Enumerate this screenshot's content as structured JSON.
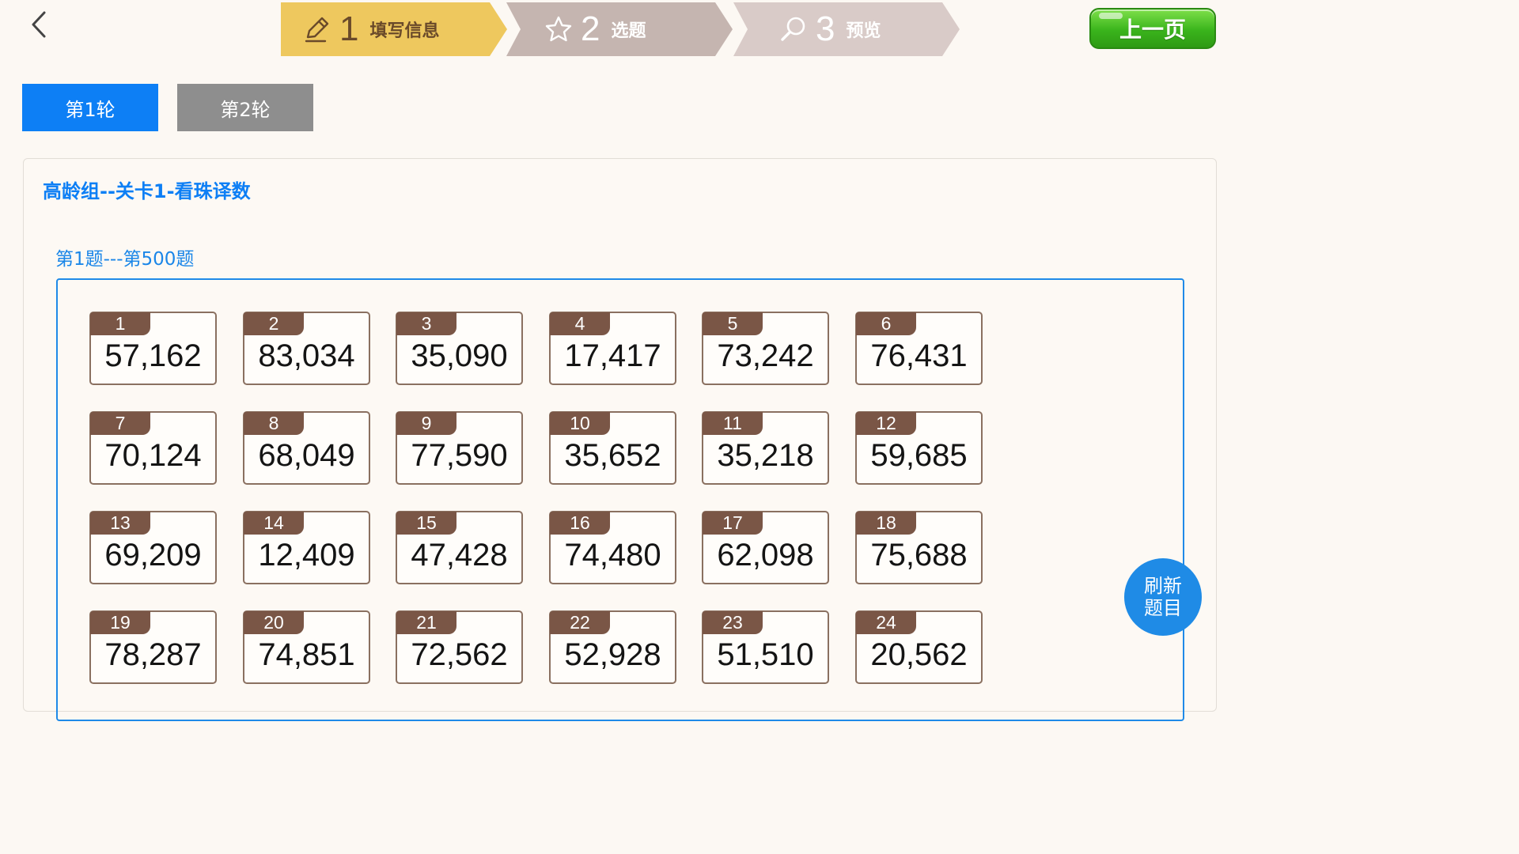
{
  "nav": {
    "back_icon": "chevron-left-icon"
  },
  "steps": [
    {
      "number": "1",
      "label": "填写信息",
      "icon": "pencil-icon",
      "color": "#eec85e"
    },
    {
      "number": "2",
      "label": "选题",
      "icon": "star-icon",
      "color": "#c5b5b0"
    },
    {
      "number": "3",
      "label": "预览",
      "icon": "magnifier-icon",
      "color": "#d9cbc8"
    }
  ],
  "header": {
    "prev_page_label": "上一页"
  },
  "rounds": [
    {
      "label": "第1轮",
      "active": true
    },
    {
      "label": "第2轮",
      "active": false
    }
  ],
  "panel": {
    "title": "高龄组--关卡1-看珠译数",
    "range_label": "第1题---第500题"
  },
  "questions": [
    {
      "id": "1",
      "value": "57,162"
    },
    {
      "id": "2",
      "value": "83,034"
    },
    {
      "id": "3",
      "value": "35,090"
    },
    {
      "id": "4",
      "value": "17,417"
    },
    {
      "id": "5",
      "value": "73,242"
    },
    {
      "id": "6",
      "value": "76,431"
    },
    {
      "id": "7",
      "value": "70,124"
    },
    {
      "id": "8",
      "value": "68,049"
    },
    {
      "id": "9",
      "value": "77,590"
    },
    {
      "id": "10",
      "value": "35,652"
    },
    {
      "id": "11",
      "value": "35,218"
    },
    {
      "id": "12",
      "value": "59,685"
    },
    {
      "id": "13",
      "value": "69,209"
    },
    {
      "id": "14",
      "value": "12,409"
    },
    {
      "id": "15",
      "value": "47,428"
    },
    {
      "id": "16",
      "value": "74,480"
    },
    {
      "id": "17",
      "value": "62,098"
    },
    {
      "id": "18",
      "value": "75,688"
    },
    {
      "id": "19",
      "value": "78,287"
    },
    {
      "id": "20",
      "value": "74,851"
    },
    {
      "id": "21",
      "value": "72,562"
    },
    {
      "id": "22",
      "value": "52,928"
    },
    {
      "id": "23",
      "value": "51,510"
    },
    {
      "id": "24",
      "value": "20,562"
    }
  ],
  "refresh": {
    "line1": "刷新",
    "line2": "题目"
  },
  "colors": {
    "accent_blue": "#0d7ff5",
    "tab_inactive": "#8e8e8e",
    "tag_brown": "#7a5646",
    "button_green": "#3ab41c"
  }
}
